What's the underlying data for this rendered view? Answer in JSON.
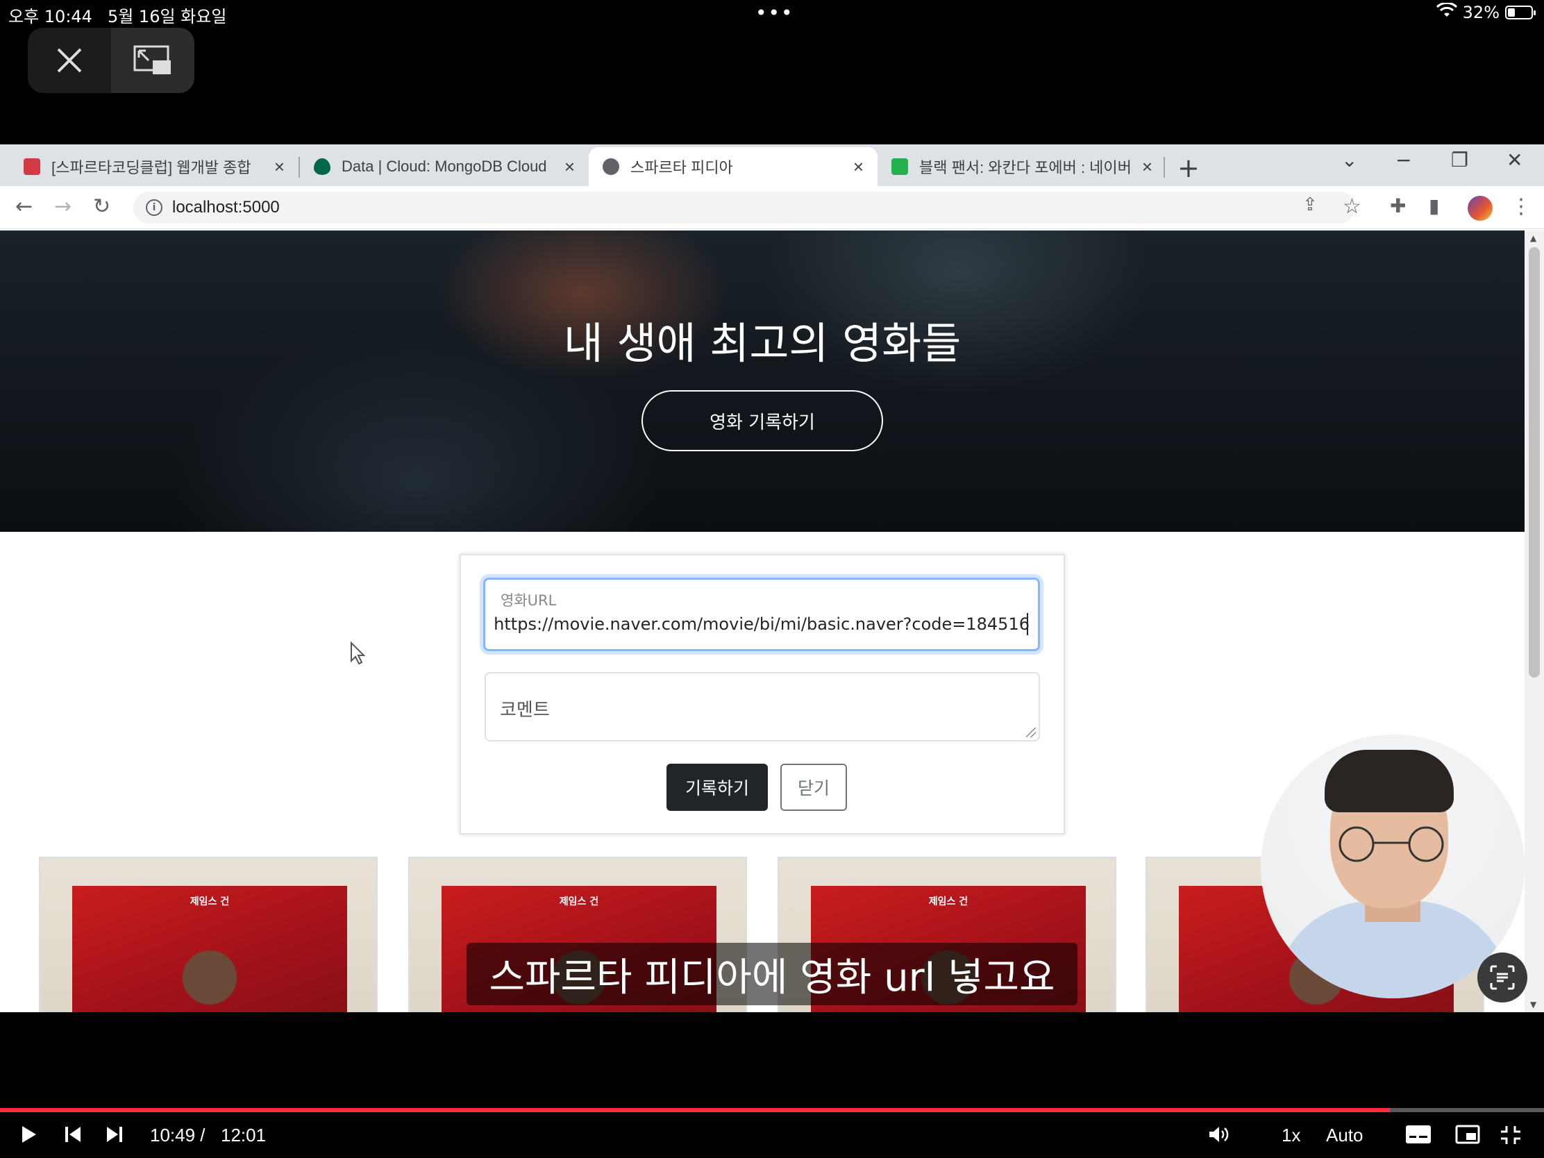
{
  "status_bar": {
    "time": "오후 10:44",
    "date": "5월 16일 화요일",
    "dots": "•••",
    "battery": "32%"
  },
  "browser": {
    "tabs": [
      {
        "title": "[스파르타코딩클럽] 웹개발 종합",
        "favicon_color": "#d33a45",
        "active": false
      },
      {
        "title": "Data | Cloud: MongoDB Cloud",
        "favicon_color": "#00684a",
        "active": false
      },
      {
        "title": "스파르타 피디아",
        "favicon_color": "#5f6368",
        "active": true
      },
      {
        "title": "블랙 팬서: 와칸다 포에버 : 네이버",
        "favicon_color": "#22b14c",
        "active": false
      }
    ],
    "url": "localhost:5000"
  },
  "page": {
    "hero_title": "내 생애 최고의 영화들",
    "hero_button": "영화 기록하기",
    "form": {
      "url_label": "영화URL",
      "url_value": "https://movie.naver.com/movie/bi/mi/basic.naver?code=184516",
      "comment_placeholder": "코멘트",
      "submit_label": "기록하기",
      "close_label": "닫기"
    },
    "cards": [
      {
        "poster_title": "제임스 건"
      },
      {
        "poster_title": "제임스 건"
      },
      {
        "poster_title": "제임스 건"
      },
      {
        "poster_title": "제임스 건"
      }
    ]
  },
  "caption": "스파르타 피디아에 영화 url 넣고요",
  "player": {
    "current_time": "10:49 /",
    "duration": "12:01",
    "progress_fraction": 0.9,
    "speed": "1x",
    "quality": "Auto"
  }
}
